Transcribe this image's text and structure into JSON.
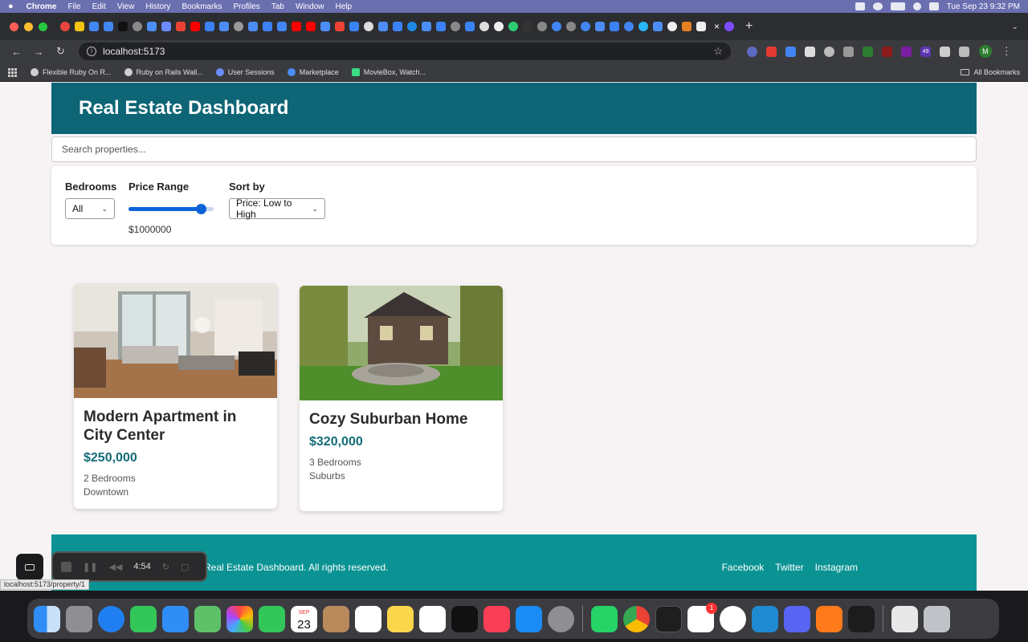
{
  "menubar": {
    "apple": "",
    "app": "Chrome",
    "items": [
      "File",
      "Edit",
      "View",
      "History",
      "Bookmarks",
      "Profiles",
      "Tab",
      "Window",
      "Help"
    ],
    "datetime": "Tue Sep 23  9:32 PM"
  },
  "browser": {
    "url": "localhost:5173",
    "tab_close": "×",
    "new_tab": "+",
    "bookmarks": [
      {
        "label": "Flexible Ruby On R...",
        "icon": "info-icon",
        "color": "#cfcfcf"
      },
      {
        "label": "Ruby on Rails Wall...",
        "icon": "github-icon",
        "color": "#cfcfcf"
      },
      {
        "label": "User Sessions",
        "icon": "bolt-icon",
        "color": "#6b8cff"
      },
      {
        "label": "Marketplace",
        "icon": "meta-icon",
        "color": "#4c8df6"
      },
      {
        "label": "MovieBox, Watch...",
        "icon": "play-icon",
        "color": "#3ddc84"
      }
    ],
    "all_bookmarks": "All Bookmarks",
    "profile_initial": "M",
    "extension_badge": "49",
    "status_url": "localhost:5173/property/1"
  },
  "page": {
    "title": "Real Estate Dashboard",
    "search_placeholder": "Search properties...",
    "filters": {
      "bedrooms_label": "Bedrooms",
      "bedrooms_value": "All",
      "price_label": "Price Range",
      "price_value": "$1000000",
      "price_fraction": 0.9,
      "sort_label": "Sort by",
      "sort_value": "Price: Low to High"
    },
    "properties": [
      {
        "title": "Modern Apartment in City Center",
        "price": "$250,000",
        "bedrooms": "2 Bedrooms",
        "location": "Downtown"
      },
      {
        "title": "Cozy Suburban Home",
        "price": "$320,000",
        "bedrooms": "3 Bedrooms",
        "location": "Suburbs"
      }
    ],
    "footer": {
      "text": "Real Estate Dashboard. All rights reserved.",
      "links": [
        "Facebook",
        "Twitter",
        "Instagram"
      ]
    }
  },
  "recorder": {
    "time": "4:54"
  },
  "dock": {
    "calendar_month": "SEP",
    "calendar_day": "23",
    "slack_badge": "1"
  },
  "colors": {
    "header_bg": "#0d6576",
    "footer_bg": "#0b9393",
    "price_text": "#136b78",
    "slider_accent": "#0b63d8"
  }
}
